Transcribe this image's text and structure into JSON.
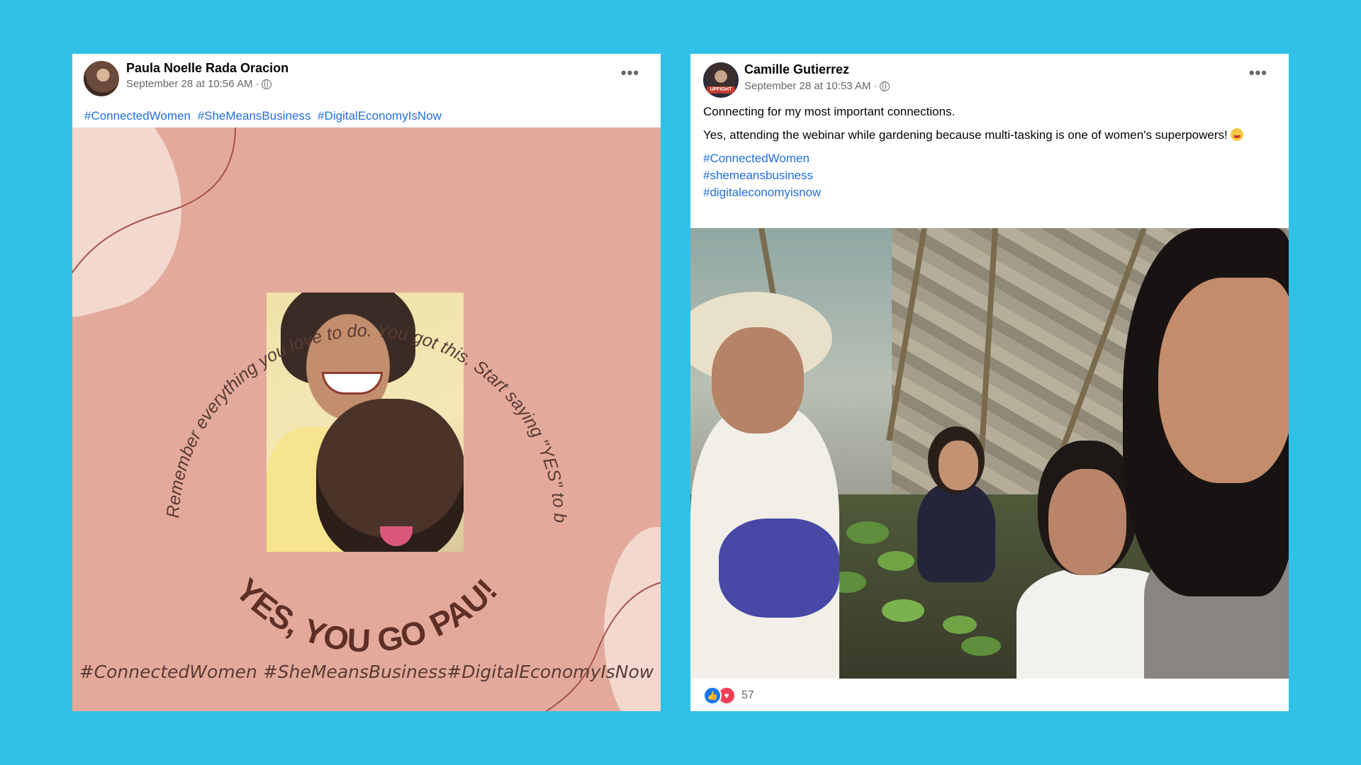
{
  "post1": {
    "author": "Paula Noelle Rada Oracion",
    "timestamp": "September 28 at 10:56 AM",
    "separator": "·",
    "audience_icon": "globe-icon",
    "more_label": "•••",
    "hashtags": [
      "#ConnectedWomen",
      "#SheMeansBusiness",
      "#DigitalEconomyIsNow"
    ],
    "image": {
      "arc_quote": "Remember everything you love to do. You got this. Start saying \"YES\" to building your dreams.",
      "headline": "YES, YOU GO PAU!",
      "bottom_hashtags": "#ConnectedWomen #SheMeansBusiness#DigitalEconomyIsNow"
    }
  },
  "post2": {
    "author": "Camille Gutierrez",
    "avatar_badge": "UPFIGHT",
    "timestamp": "September 28 at 10:53 AM",
    "separator": "·",
    "audience_icon": "globe-icon",
    "more_label": "•••",
    "text_line1": "Connecting for my most important connections.",
    "text_line2": "Yes, attending the webinar while gardening because multi-tasking is one of women's superpowers!",
    "hashtags": [
      "#ConnectedWomen",
      "#shemeansbusiness",
      "#digitaleconomyisnow"
    ],
    "reactions": {
      "icons": [
        "like-icon",
        "love-icon"
      ],
      "count": "57"
    }
  },
  "colors": {
    "background": "#31c1e6",
    "link": "#216fdb",
    "poster_bg": "#e3aa9b",
    "poster_text": "#5a3a35"
  }
}
